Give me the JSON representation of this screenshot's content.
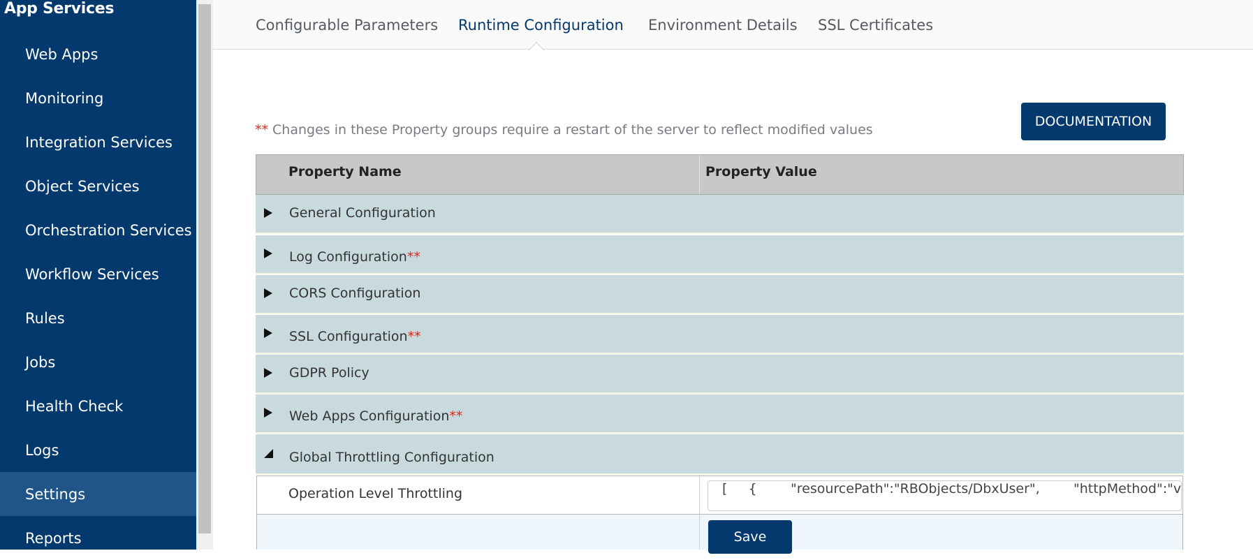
{
  "sidebar": {
    "title": "App Services",
    "items": [
      {
        "label": "Web Apps"
      },
      {
        "label": "Monitoring"
      },
      {
        "label": "Integration Services"
      },
      {
        "label": "Object Services"
      },
      {
        "label": "Orchestration Services"
      },
      {
        "label": "Workflow Services"
      },
      {
        "label": "Rules"
      },
      {
        "label": "Jobs"
      },
      {
        "label": "Health Check"
      },
      {
        "label": "Logs"
      },
      {
        "label": "Settings",
        "active": true
      },
      {
        "label": "Reports"
      }
    ]
  },
  "tabs": [
    {
      "label": "Configurable Parameters"
    },
    {
      "label": "Runtime Configuration",
      "active": true
    },
    {
      "label": "Environment Details"
    },
    {
      "label": "SSL Certificates"
    }
  ],
  "notice": {
    "stars": "**",
    "text": " Changes in these Property groups require a restart of the server to reflect modified values"
  },
  "documentation_button": "DOCUMENTATION",
  "table": {
    "headers": {
      "name": "Property Name",
      "value": "Property Value"
    },
    "groups": [
      {
        "label": "General Configuration",
        "stars": "",
        "expanded": false
      },
      {
        "label": "Log Configuration",
        "stars": "**",
        "expanded": false
      },
      {
        "label": "CORS Configuration",
        "stars": "",
        "expanded": false
      },
      {
        "label": "SSL Configuration",
        "stars": "**",
        "expanded": false
      },
      {
        "label": "GDPR Policy",
        "stars": "",
        "expanded": false
      },
      {
        "label": "Web Apps Configuration",
        "stars": "**",
        "expanded": false
      },
      {
        "label": "Global Throttling Configuration",
        "stars": "",
        "expanded": true
      }
    ],
    "property": {
      "name": "Operation Level Throttling",
      "value": "[     {        \"resourcePath\":\"RBObjects/DbxUser\",        \"httpMethod\":\"verifyE"
    },
    "save_label": "Save"
  },
  "colors": {
    "sidebar_bg": "#03396c",
    "sidebar_active": "#1f5589",
    "group_row_bg": "#c9dadf",
    "accent": "#03396c",
    "required_star": "#e0261b"
  }
}
